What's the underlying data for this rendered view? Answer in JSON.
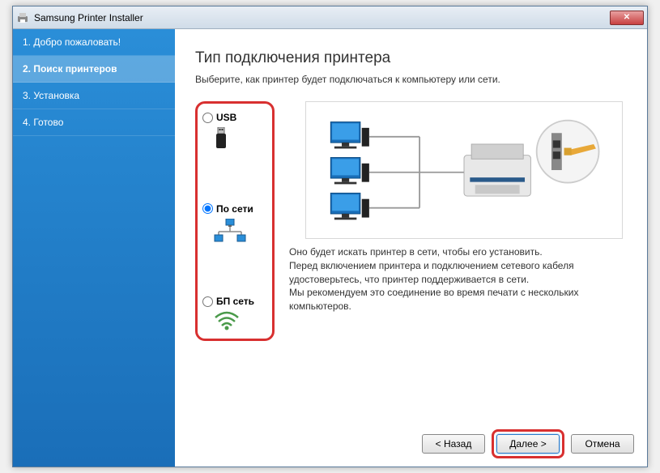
{
  "window": {
    "title": "Samsung Printer Installer"
  },
  "sidebar": {
    "items": [
      {
        "label": "1. Добро пожаловать!"
      },
      {
        "label": "2. Поиск принтеров"
      },
      {
        "label": "3. Установка"
      },
      {
        "label": "4. Готово"
      }
    ]
  },
  "main": {
    "title": "Тип подключения принтера",
    "subtitle": "Выберите, как принтер будет подключаться к компьютеру или сети.",
    "options": {
      "usb": "USB",
      "network": "По сети",
      "wireless": "БП сеть"
    },
    "description": "Оно будет искать принтер в сети, чтобы его установить.\nПеред включением принтера и подключением сетевого кабеля удостоверьтесь, что принтер поддерживается в сети.\nМы рекомендуем это соединение во время печати с нескольких компьютеров."
  },
  "buttons": {
    "back": "< Назад",
    "next": "Далее >",
    "cancel": "Отмена"
  }
}
